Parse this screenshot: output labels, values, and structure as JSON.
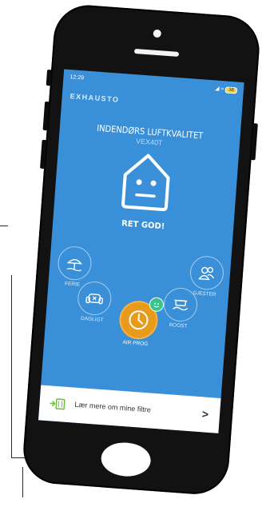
{
  "status_bar": {
    "time": "12:29",
    "icons": "◢ ≈",
    "battery": "38"
  },
  "app": {
    "brand": "EXHAUSTO",
    "title": "INDENDØRS LUFTKVALITET",
    "model": "VEX40T",
    "air_quality_label": "RET GOD!"
  },
  "modes": {
    "ferie": "FERIE",
    "gaester": "GÆSTER",
    "dagligt": "DAGLIGT",
    "boost": "BOOST",
    "air_prog": "AIR PROG"
  },
  "footer": {
    "filter_label": "Lær mere om mine filtre",
    "chevron": ">"
  },
  "colors": {
    "screen_bg": "#3a90d8",
    "air_prog": "#e89a1b",
    "badge": "#37c38a",
    "phone_body": "#121212"
  },
  "icons": [
    "house-face-icon",
    "beach-umbrella-icon",
    "people-icon",
    "armchair-icon",
    "clock-icon",
    "pot-steam-icon",
    "filter-icon",
    "chevron-right-icon"
  ]
}
